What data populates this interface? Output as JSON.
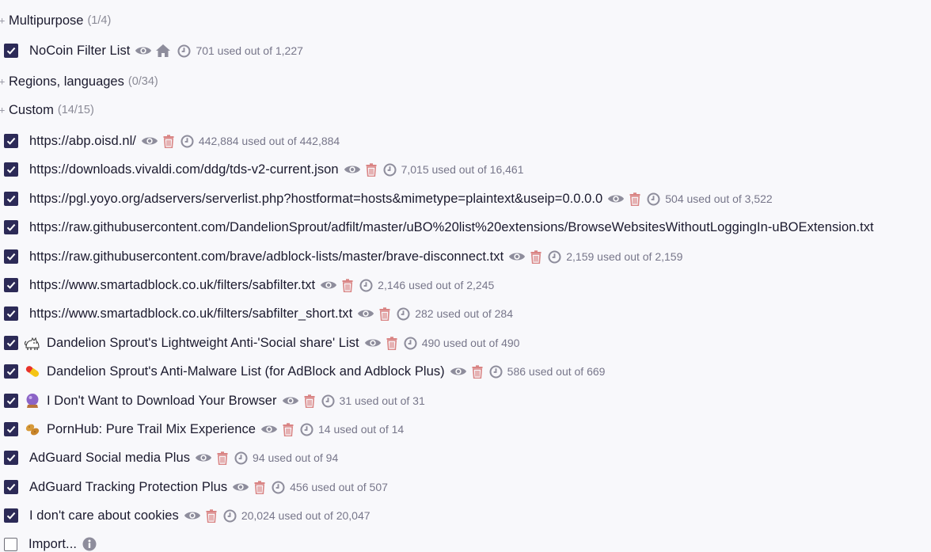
{
  "groups": {
    "multipurpose": {
      "label": "Multipurpose",
      "count": "(1/4)"
    },
    "regions": {
      "label": "Regions, languages",
      "count": "(0/34)"
    },
    "custom": {
      "label": "Custom",
      "count": "(14/15)"
    }
  },
  "expander_glyph": "+",
  "nocoin": {
    "name": "NoCoin Filter List",
    "stats": "701 used out of 1,227",
    "checked": true
  },
  "custom_lists": [
    {
      "name": "https://abp.oisd.nl/",
      "stats": "442,884 used out of 442,884"
    },
    {
      "name": "https://downloads.vivaldi.com/ddg/tds-v2-current.json",
      "stats": "7,015 used out of 16,461"
    },
    {
      "name": "https://pgl.yoyo.org/adservers/serverlist.php?hostformat=hosts&mimetype=plaintext&useip=0.0.0.0",
      "stats": "504 used out of 3,522"
    },
    {
      "name": "https://raw.githubusercontent.com/DandelionSprout/adfilt/master/uBO%20list%20extensions/BrowseWebsitesWithoutLoggingIn-uBOExtension.txt",
      "stats": ""
    },
    {
      "name": "https://raw.githubusercontent.com/brave/adblock-lists/master/brave-disconnect.txt",
      "stats": "2,159 used out of 2,159"
    },
    {
      "name": "https://www.smartadblock.co.uk/filters/sabfilter.txt",
      "stats": "2,146 used out of 2,245"
    },
    {
      "name": "https://www.smartadblock.co.uk/filters/sabfilter_short.txt",
      "stats": "282 used out of 284"
    },
    {
      "name": "Dandelion Sprout's Lightweight Anti-'Social share' List",
      "stats": "490 used out of 490",
      "emoji": "cat-emoji"
    },
    {
      "name": "Dandelion Sprout's Anti-Malware List (for AdBlock and Adblock Plus)",
      "stats": "586 used out of 669",
      "emoji": "pill-emoji"
    },
    {
      "name": "I Don't Want to Download Your Browser",
      "stats": "31 used out of 31",
      "emoji": "crystal-ball-emoji"
    },
    {
      "name": "PornHub: Pure Trail Mix Experience",
      "stats": "14 used out of 14",
      "emoji": "peanuts-emoji"
    },
    {
      "name": "AdGuard Social media Plus",
      "stats": "94 used out of 94"
    },
    {
      "name": "AdGuard Tracking Protection Plus",
      "stats": "456 used out of 507"
    },
    {
      "name": "I don't care about cookies",
      "stats": "20,024 used out of 20,047"
    }
  ],
  "import": {
    "label": "Import...",
    "checked": false
  },
  "colors": {
    "checkbox": "#2c2a57",
    "icon": "#8e8d9c",
    "trash": "#d98484",
    "text": "#1b1a2e",
    "muted": "#77768a"
  },
  "icons": {
    "view": "eye-icon",
    "home": "home-icon",
    "delete": "trash-icon",
    "updated": "clock-icon",
    "info": "info-icon"
  }
}
